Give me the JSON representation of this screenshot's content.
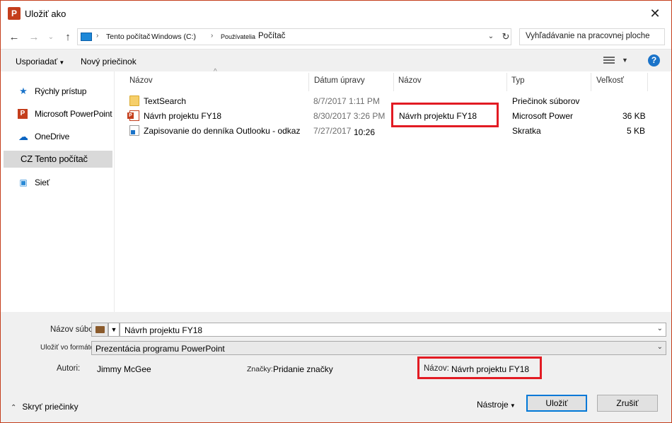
{
  "window": {
    "title": "Uložiť ako",
    "app_icon": "P"
  },
  "nav": {
    "breadcrumbs": [
      "Tento počítač",
      "Windows (C:)",
      "Používatelia",
      "Počítač"
    ],
    "search_placeholder": "Vyhľadávanie na pracovnej ploche"
  },
  "toolbar": {
    "organize": "Usporiadať",
    "new_folder": "Nový priečinok"
  },
  "sidebar": {
    "items": [
      {
        "label": "Rýchly prístup",
        "icon": "star-icon"
      },
      {
        "label": "Microsoft PowerPoint",
        "icon": "powerpoint-icon"
      },
      {
        "label": "OneDrive",
        "icon": "cloud-icon"
      },
      {
        "label": "CZ Tento počítač",
        "icon": "computer-icon",
        "selected": true
      },
      {
        "label": "Sieť",
        "icon": "network-icon"
      }
    ]
  },
  "file_list": {
    "columns": [
      "Názov",
      "Dátum úpravy",
      "Názov",
      "Typ",
      "Veľkosť"
    ],
    "rows": [
      {
        "name": "TextSearch",
        "date": "8/7/2017 1:11 PM",
        "title": "",
        "type": "Priečinok súborov",
        "size": "",
        "icon": "folder-icon"
      },
      {
        "name": "Návrh projektu FY18",
        "date": "8/30/2017 3:26 PM",
        "title": "Návrh projektu FY18",
        "type": "Microsoft Power",
        "size": "36 KB",
        "icon": "powerpoint-file-icon"
      },
      {
        "name": "Zapisovanie do denníka Outlooku - odkaz",
        "date": "7/27/2017",
        "time": "10:26",
        "title": "",
        "type": "Skratka",
        "size": "5 KB",
        "icon": "shortcut-icon"
      }
    ]
  },
  "form": {
    "filename_label": "Názov súboru:",
    "filename_value": "Návrh projektu FY18",
    "filetype_label": "Uložiť vo formáte:",
    "filetype_value": "Prezentácia programu PowerPoint",
    "authors_label": "Autori:",
    "authors_value": "Jimmy McGee",
    "tags_label": "Značky:",
    "tags_value": "Pridanie značky",
    "title_label": "Názov:",
    "title_value": "Návrh projektu FY18"
  },
  "footer": {
    "hide_folders": "Skryť priečinky",
    "tools": "Nástroje",
    "save": "Uložiť",
    "cancel": "Zrušiť"
  },
  "colors": {
    "accent": "#c43e1c",
    "highlight": "#e21b23",
    "primary_button_border": "#0078d7"
  }
}
